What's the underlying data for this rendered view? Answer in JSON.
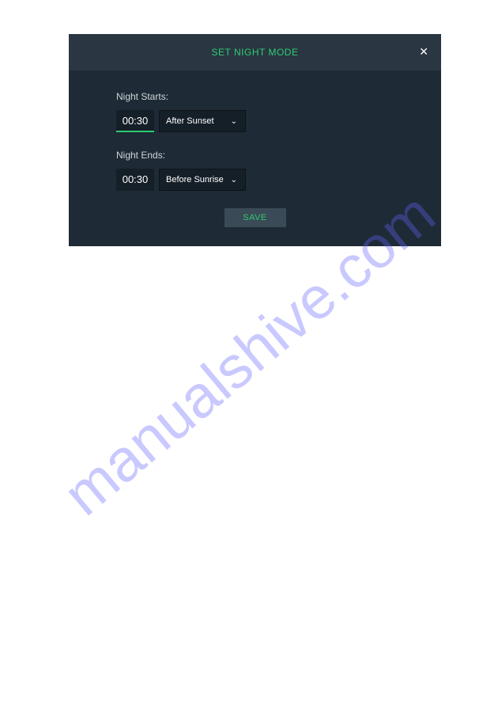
{
  "modal": {
    "title": "SET NIGHT MODE",
    "close_label": "✕",
    "night_starts": {
      "label": "Night Starts:",
      "time": "00:30",
      "dropdown": "After Sunset"
    },
    "night_ends": {
      "label": "Night Ends:",
      "time": "00:30",
      "dropdown": "Before Sunrise"
    },
    "save_label": "SAVE"
  },
  "watermark": "manualshive.com"
}
